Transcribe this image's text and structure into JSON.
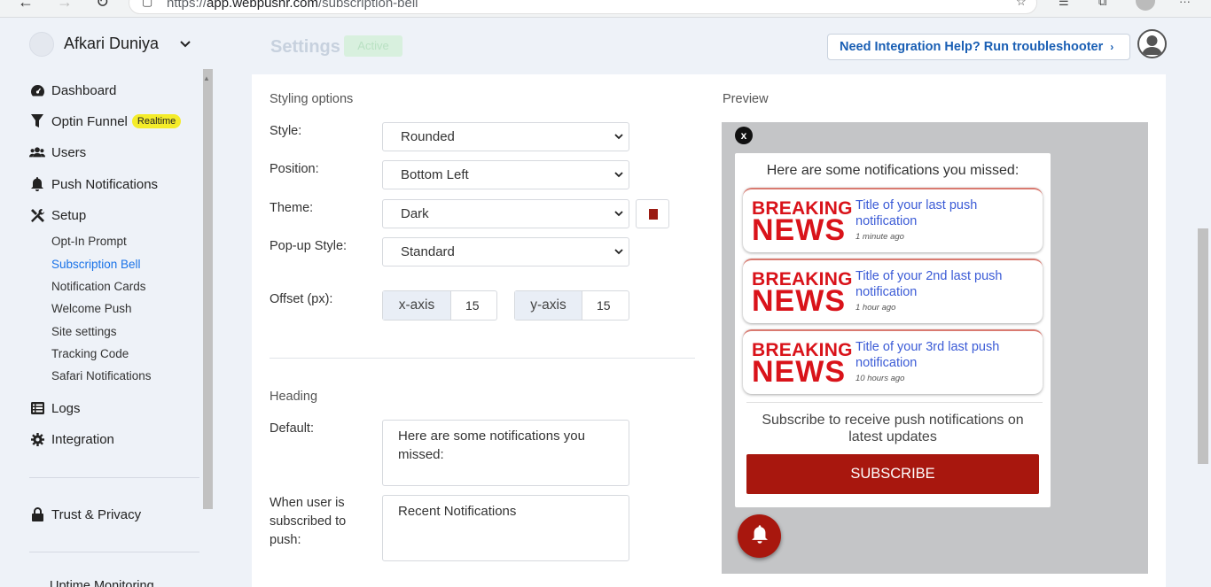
{
  "browser": {
    "url_prefix": "https://",
    "url_host": "app.webpushr.com",
    "url_path": "/subscription-bell"
  },
  "sidebar": {
    "brand_name": "Afkari Duniya",
    "items": [
      {
        "label": "Dashboard",
        "icon": "gauge-icon"
      },
      {
        "label": "Optin Funnel",
        "icon": "funnel-icon",
        "badge": "Realtime"
      },
      {
        "label": "Users",
        "icon": "users-icon"
      },
      {
        "label": "Push Notifications",
        "icon": "bell-icon"
      },
      {
        "label": "Setup",
        "icon": "tools-icon"
      }
    ],
    "setup_sub": [
      "Opt-In Prompt",
      "Subscription Bell",
      "Notification Cards",
      "Welcome Push",
      "Site settings",
      "Tracking Code",
      "Safari Notifications"
    ],
    "active_sub": "Subscription Bell",
    "items_bottom": [
      {
        "label": "Logs",
        "icon": "list-icon"
      },
      {
        "label": "Integration",
        "icon": "gear-icon"
      }
    ],
    "trust": "Trust & Privacy",
    "uptime": "Uptime Monitoring"
  },
  "header": {
    "faint_title": "Settings",
    "faint_badge": "Active",
    "help_button": "Need Integration Help? Run troubleshooter"
  },
  "styling": {
    "section_title": "Styling options",
    "style_label": "Style:",
    "style_value": "Rounded",
    "position_label": "Position:",
    "position_value": "Bottom Left",
    "theme_label": "Theme:",
    "theme_value": "Dark",
    "theme_color": "#9b1b12",
    "popup_label": "Pop-up Style:",
    "popup_value": "Standard",
    "offset_label": "Offset (px):",
    "x_axis_label": "x-axis",
    "x_axis_value": "15",
    "y_axis_label": "y-axis",
    "y_axis_value": "15"
  },
  "heading": {
    "section_title": "Heading",
    "default_label": "Default:",
    "default_value": "Here are some notifications you missed:",
    "subscribed_label": "When user is subscribed to push:",
    "subscribed_value": "Recent Notifications"
  },
  "preview": {
    "title": "Preview",
    "close": "x",
    "heading": "Here are some notifications you missed:",
    "notifications": [
      {
        "img_line1": "BREAKING",
        "img_line2": "NEWS",
        "title": "Title of your last push notification",
        "time": "1 minute ago"
      },
      {
        "img_line1": "BREAKING",
        "img_line2": "NEWS",
        "title": "Title of your 2nd last push notification",
        "time": "1 hour ago"
      },
      {
        "img_line1": "BREAKING",
        "img_line2": "NEWS",
        "title": "Title of your 3rd last push notification",
        "time": "10 hours ago"
      }
    ],
    "subscribe_text": "Subscribe to receive push notifications on latest updates",
    "subscribe_button": "SUBSCRIBE",
    "accent_color": "#a8170e"
  }
}
